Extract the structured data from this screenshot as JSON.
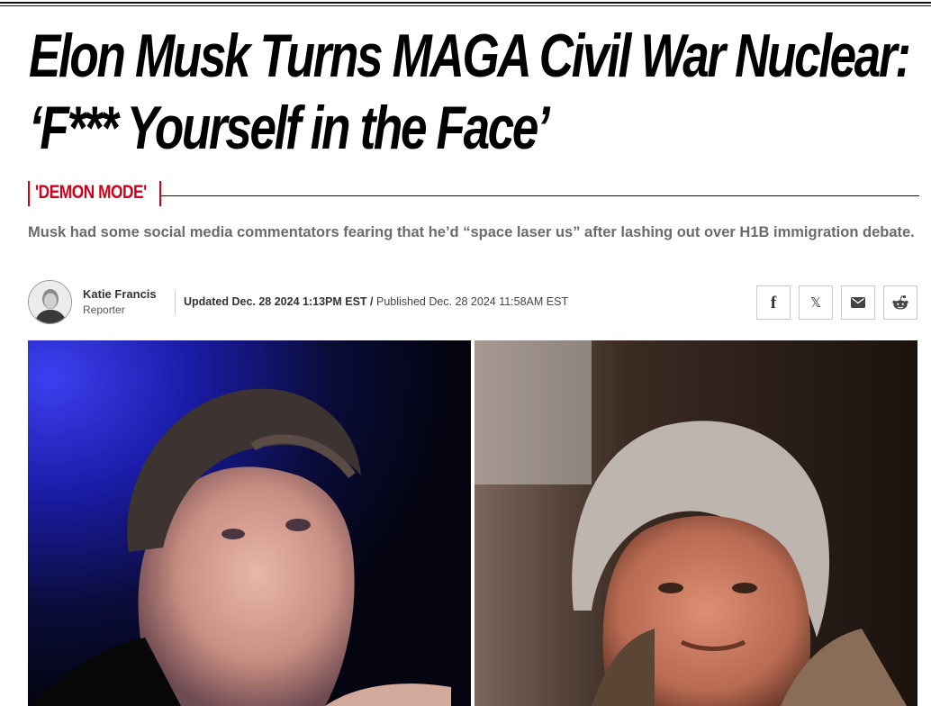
{
  "article": {
    "headline": "Elon Musk Turns MAGA Civil War Nuclear: ‘F*** Yourself in the Face’",
    "rubric": "'DEMON MODE'",
    "dek": "Musk had some social media commentators fearing that he’d “space laser us” after lashing out over H1B immigration debate."
  },
  "byline": {
    "author_name": "Katie Francis",
    "author_role": "Reporter",
    "updated": "Updated Dec. 28 2024 1:13PM EST",
    "separator": " / ",
    "published": "Published Dec. 28 2024 11:58AM EST"
  },
  "share": {
    "facebook_glyph": "f",
    "x_glyph": "𝕏"
  },
  "icons": [
    "avatar",
    "facebook-icon",
    "x-icon",
    "email-icon",
    "reddit-icon"
  ],
  "colors": {
    "accent": "#d0021b",
    "dek": "#6b6b6b",
    "text": "#111111"
  }
}
